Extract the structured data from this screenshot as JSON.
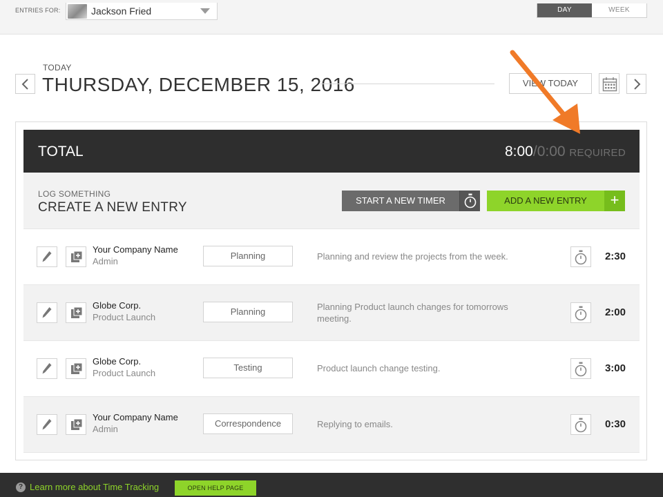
{
  "header": {
    "entries_for_label": "ENTRIES FOR:",
    "user_name": "Jackson Fried",
    "view_toggle": {
      "day": "DAY",
      "week": "WEEK",
      "selected": "DAY"
    }
  },
  "date_nav": {
    "today_label": "TODAY",
    "date_title": "THURSDAY, DECEMBER 15, 2016",
    "view_today_label": "VIEW TODAY"
  },
  "total": {
    "label": "TOTAL",
    "logged": "8:00",
    "separator": "/",
    "required_time": "0:00",
    "required_word": "REQUIRED"
  },
  "log": {
    "small_label": "LOG SOMETHING",
    "big_label": "CREATE A NEW ENTRY",
    "start_timer_label": "START A NEW TIMER",
    "add_entry_label": "ADD A NEW ENTRY",
    "add_entry_icon": "+"
  },
  "entries": [
    {
      "client": "Your Company Name",
      "project": "Admin",
      "task": "Planning",
      "notes": "Planning and review the projects from the week.",
      "hours": "2:30"
    },
    {
      "client": "Globe Corp.",
      "project": "Product Launch",
      "task": "Planning",
      "notes": "Planning Product launch changes for tomorrows meeting.",
      "hours": "2:00"
    },
    {
      "client": "Globe Corp.",
      "project": "Product Launch",
      "task": "Testing",
      "notes": "Product launch change testing.",
      "hours": "3:00"
    },
    {
      "client": "Your Company Name",
      "project": "Admin",
      "task": "Correspondence",
      "notes": "Replying to emails.",
      "hours": "0:30"
    }
  ],
  "footer": {
    "help_icon": "?",
    "help_text": "Learn more about Time Tracking",
    "help_button_label": "OPEN HELP PAGE"
  },
  "colors": {
    "accent_green": "#8ed42a",
    "dark_bar": "#2e2e2e",
    "annotation_orange": "#f07a28"
  }
}
